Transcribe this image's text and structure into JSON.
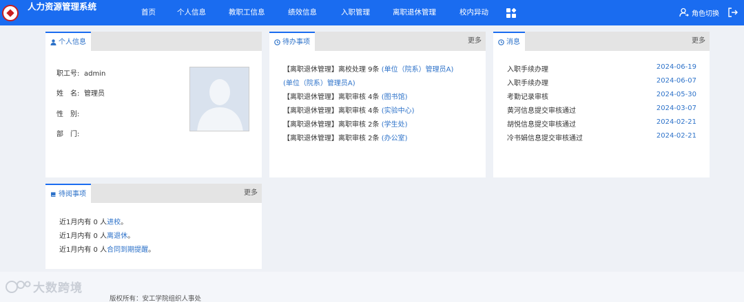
{
  "header": {
    "title": "人力资源管理系统",
    "nav": [
      "首页",
      "个人信息",
      "教职工信息",
      "绩效信息",
      "入职管理",
      "离职退休管理",
      "校内异动"
    ],
    "role_switch": "角色切换"
  },
  "profile": {
    "tab": "个人信息",
    "id_label": "职工号:",
    "id_value": "admin",
    "name_label": "姓　名:",
    "name_value": "管理员",
    "gender_label": "性　别:",
    "dept_label": "部　门:"
  },
  "todo": {
    "tab": "待办事项",
    "more": "更多",
    "items": [
      {
        "prefix": "【离职退休管理】离校处理 9条 ",
        "link": "(单位（院系）管理员A)"
      },
      {
        "prefix": "",
        "link": "(单位（院系）管理员A)"
      },
      {
        "prefix": "【离职退休管理】离职审核 4条 ",
        "link": "(图书馆)"
      },
      {
        "prefix": "【离职退休管理】离职审核 4条 ",
        "link": "(实验中心)"
      },
      {
        "prefix": "【离职退休管理】离职审核 2条 ",
        "link": "(学生处)"
      },
      {
        "prefix": "【离职退休管理】离职审核 2条 ",
        "link": "(办公室)"
      }
    ]
  },
  "messages": {
    "tab": "消息",
    "more": "更多",
    "items": [
      {
        "title": "入职手续办理",
        "date": "2024-06-19"
      },
      {
        "title": "入职手续办理",
        "date": "2024-06-07"
      },
      {
        "title": "考勤记录审核",
        "date": "2024-05-30"
      },
      {
        "title": "黄河信息提交审核通过",
        "date": "2024-03-07"
      },
      {
        "title": "胡悦信息提交审核通过",
        "date": "2024-02-21"
      },
      {
        "title": "冷书娟信息提交审核通过",
        "date": "2024-02-21"
      }
    ]
  },
  "toread": {
    "tab": "待阅事项",
    "more": "更多",
    "items": [
      {
        "prefix": "近1月内有 0 人",
        "link": "进校",
        "suffix": "。"
      },
      {
        "prefix": "近1月内有 0 人",
        "link": "离退休",
        "suffix": "。"
      },
      {
        "prefix": "近1月内有 0 人",
        "link": "合同到期提醒",
        "suffix": "。"
      }
    ]
  },
  "footer": {
    "copyright": "版权所有：安工学院组织人事处",
    "watermark": "大数跨境"
  },
  "colors": {
    "header_bg": "#1a6cf0",
    "link": "#2d72c9",
    "page_bg": "#eef1f6"
  },
  "icons": [
    "logo",
    "apps-grid-icon",
    "user-switch-icon",
    "logout-icon",
    "user-icon",
    "clock-icon",
    "book-icon"
  ]
}
